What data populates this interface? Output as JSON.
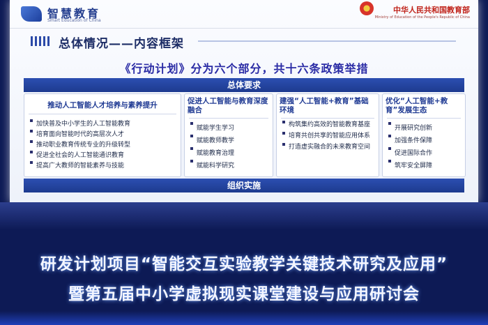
{
  "header": {
    "brand_cn": "智慧教育",
    "brand_en": "Smart Education of China",
    "ministry_cn": "中华人民共和国教育部",
    "ministry_en": "Ministry of Education of the People's Republic of China"
  },
  "section": {
    "title": "总体情况——内容框架"
  },
  "headline": "《行动计划》分为六个部分，共十六条政策举措",
  "requirements_bar": "总体要求",
  "columns": [
    {
      "title": "推动人工智能人才培养与素养提升",
      "items": [
        "加快普及中小学生的人工智能教育",
        "培育面向智能时代的高层次人才",
        "推动职业教育传统专业的升级转型",
        "促进全社会的人工智能通识教育",
        "提高广大教师的智能素养与技能"
      ]
    },
    {
      "title": "促进人工智能与教育深度融合",
      "items": [
        "赋能学生学习",
        "赋能教师教学",
        "赋能教育治理",
        "赋能科学研究"
      ]
    },
    {
      "title": "建强“人工智能+教育”基础环境",
      "items": [
        "构筑集约高效的智能教育基座",
        "培育共创共享的智能应用体系",
        "打造虚实融合的未来教育空间"
      ]
    },
    {
      "title": "优化“人工智能+教育”发展生态",
      "items": [
        "开展研究创新",
        "加强条件保障",
        "促进国际合作",
        "筑牢安全屏障"
      ]
    }
  ],
  "organization_bar": "组织实施",
  "banner": {
    "line1": "研发计划项目“智能交互实验教学关键技术研究及应用”",
    "line2": "暨第五届中小学虚拟现实课堂建设与应用研讨会"
  },
  "colors": {
    "accent_blue": "#2c4fb1",
    "title_navy": "#1d2d66",
    "headline_blue": "#2a2ba5",
    "ministry_red": "#c0241b",
    "backdrop": "#0d1a55"
  },
  "icons": [
    "smart-education-logo-icon",
    "national-emblem-icon",
    "bullet-square-icon"
  ]
}
